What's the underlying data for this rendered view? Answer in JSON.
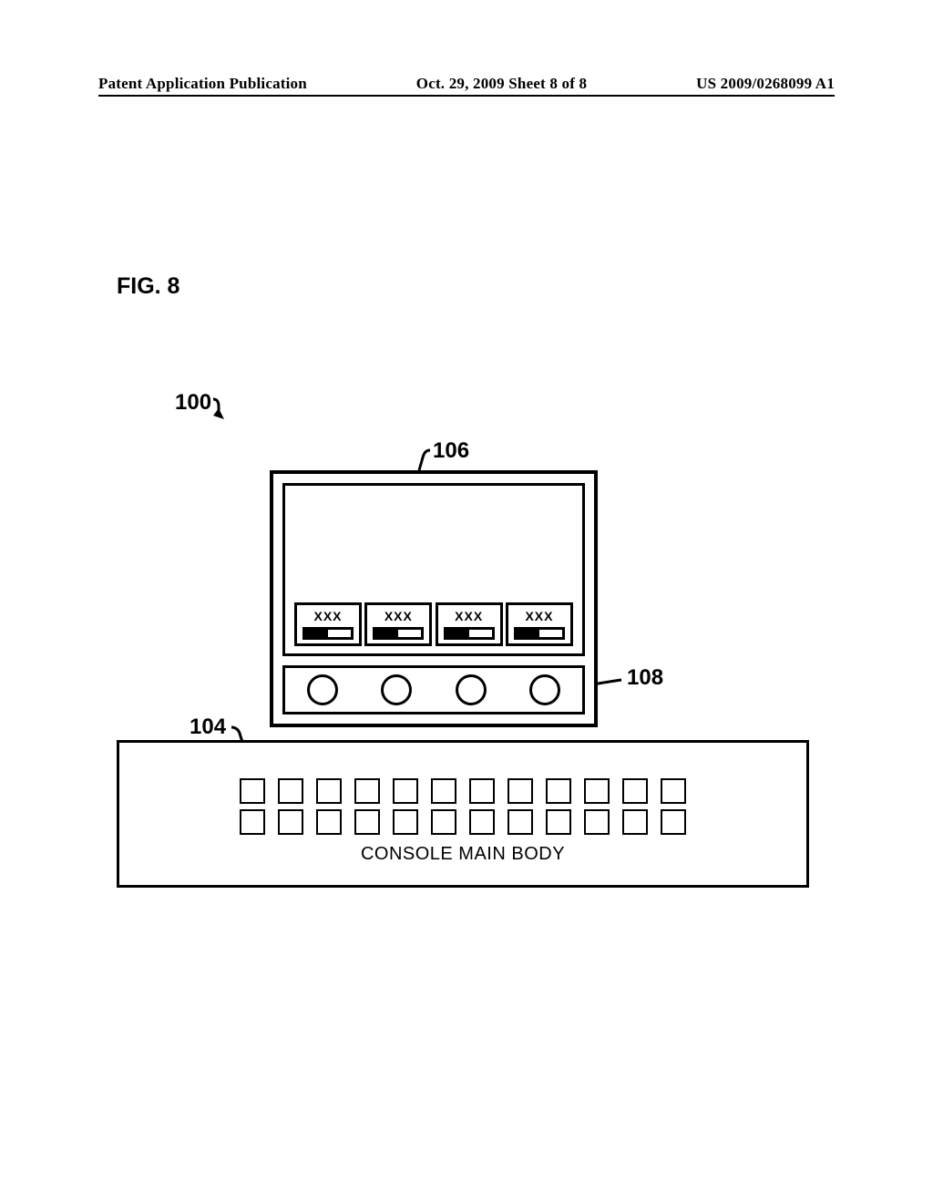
{
  "header": {
    "left": "Patent Application Publication",
    "center": "Oct. 29, 2009  Sheet 8 of 8",
    "right": "US 2009/0268099 A1"
  },
  "figure": {
    "label": "FIG. 8",
    "refs": {
      "r100": "100",
      "r104": "104",
      "r106": "106",
      "r108": "108"
    },
    "slots": [
      "XXX",
      "XXX",
      "XXX",
      "XXX"
    ],
    "console_label": "CONSOLE MAIN BODY"
  }
}
